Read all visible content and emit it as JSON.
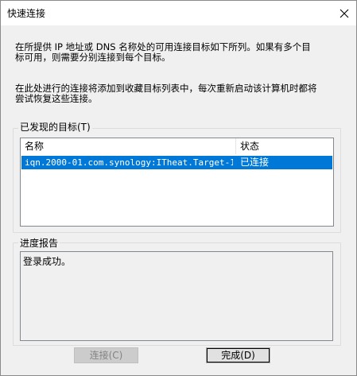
{
  "window": {
    "title": "快速连接"
  },
  "intro": {
    "line1": "在所提供 IP 地址或 DNS 名称处的可用连接目标如下所列。如果有多个目",
    "line2": "标可用，则需要分别连接到每个目标。",
    "line3": "在此处进行的连接将添加到收藏目标列表中，每次重新启动该计算机时都将",
    "line4": "尝试恢复这些连接。"
  },
  "targets": {
    "group_label": "已发现的目标(T)",
    "columns": [
      "名称",
      "状态"
    ],
    "rows": [
      {
        "name": "iqn.2000-01.com.synology:ITheat.Target-1...",
        "status": "已连接",
        "selected": true
      }
    ]
  },
  "progress": {
    "group_label": "进度报告",
    "text": "登录成功。"
  },
  "buttons": {
    "connect": "连接(C)",
    "done": "完成(D)"
  }
}
